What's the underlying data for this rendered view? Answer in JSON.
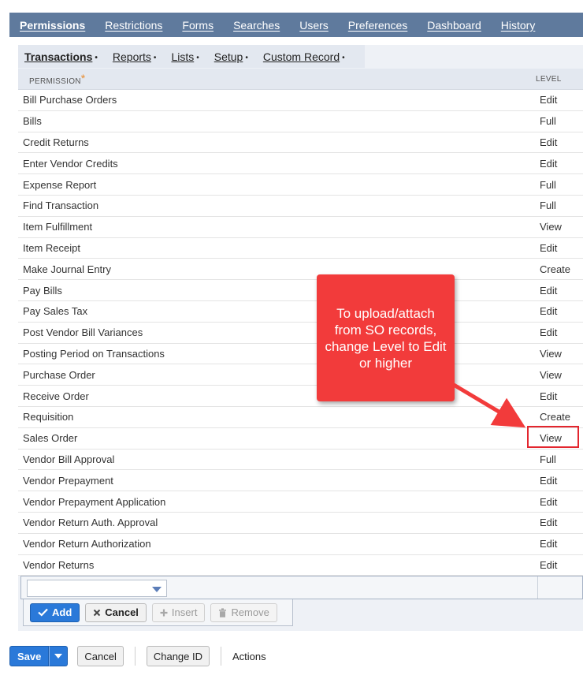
{
  "top_tabs": [
    "Permissions",
    "Restrictions",
    "Forms",
    "Searches",
    "Users",
    "Preferences",
    "Dashboard",
    "History"
  ],
  "sub_tabs": [
    "Transactions",
    "Reports",
    "Lists",
    "Setup",
    "Custom Record"
  ],
  "table": {
    "col_permission": "PERMISSION",
    "col_level": "LEVEL",
    "rows": [
      {
        "permission": "Bill Purchase Orders",
        "level": "Edit"
      },
      {
        "permission": "Bills",
        "level": "Full"
      },
      {
        "permission": "Credit Returns",
        "level": "Edit"
      },
      {
        "permission": "Enter Vendor Credits",
        "level": "Edit"
      },
      {
        "permission": "Expense Report",
        "level": "Full"
      },
      {
        "permission": "Find Transaction",
        "level": "Full"
      },
      {
        "permission": "Item Fulfillment",
        "level": "View"
      },
      {
        "permission": "Item Receipt",
        "level": "Edit"
      },
      {
        "permission": "Make Journal Entry",
        "level": "Create"
      },
      {
        "permission": "Pay Bills",
        "level": "Edit"
      },
      {
        "permission": "Pay Sales Tax",
        "level": "Edit"
      },
      {
        "permission": "Post Vendor Bill Variances",
        "level": "Edit"
      },
      {
        "permission": "Posting Period on Transactions",
        "level": "View"
      },
      {
        "permission": "Purchase Order",
        "level": "View"
      },
      {
        "permission": "Receive Order",
        "level": "Edit"
      },
      {
        "permission": "Requisition",
        "level": "Create"
      },
      {
        "permission": "Sales Order",
        "level": "View"
      },
      {
        "permission": "Vendor Bill Approval",
        "level": "Full"
      },
      {
        "permission": "Vendor Prepayment",
        "level": "Edit"
      },
      {
        "permission": "Vendor Prepayment Application",
        "level": "Edit"
      },
      {
        "permission": "Vendor Return Auth. Approval",
        "level": "Edit"
      },
      {
        "permission": "Vendor Return Authorization",
        "level": "Edit"
      },
      {
        "permission": "Vendor Returns",
        "level": "Edit"
      }
    ]
  },
  "row_buttons": {
    "add": "Add",
    "cancel": "Cancel",
    "insert": "Insert",
    "remove": "Remove"
  },
  "bottom_buttons": {
    "save": "Save",
    "cancel": "Cancel",
    "change_id": "Change ID",
    "actions": "Actions"
  },
  "callout": {
    "text": "To upload/attach from SO records, change Level to Edit or higher"
  },
  "colors": {
    "tab_bar": "#5f7a9d",
    "primary": "#2a79d9",
    "callout": "#f23b3b",
    "highlight": "#e3262e"
  }
}
